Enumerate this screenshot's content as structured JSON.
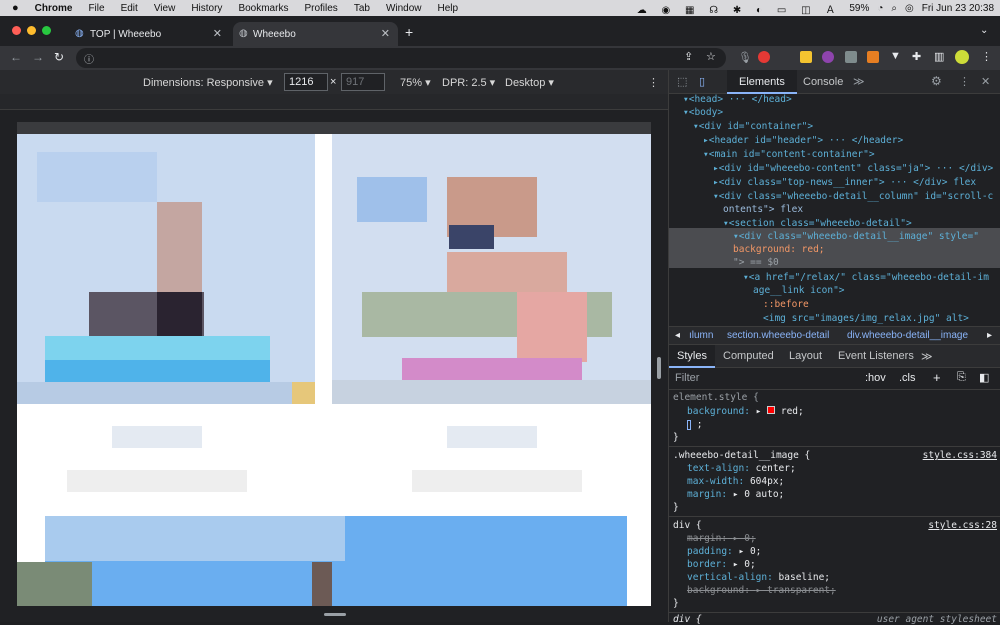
{
  "menubar": {
    "apple": "",
    "app": "Chrome",
    "items": [
      "File",
      "Edit",
      "View",
      "History",
      "Bookmarks",
      "Profiles",
      "Tab",
      "Window",
      "Help"
    ],
    "battery": "59%",
    "datetime": "Fri Jun 23  20:38"
  },
  "tabs": [
    {
      "title": "TOP | Wheeebo",
      "close": "✕"
    },
    {
      "title": "Wheeebo",
      "close": "✕"
    }
  ],
  "new_tab": "+",
  "devbar": {
    "dimensions": "Dimensions: Responsive ▾",
    "width": "1216",
    "times": "×",
    "height": "917",
    "zoom": "75% ▾",
    "dpr": "DPR: 2.5 ▾",
    "device": "Desktop ▾"
  },
  "devtools": {
    "tabs": [
      "Elements",
      "Console"
    ],
    "more": "≫"
  },
  "dom": [
    {
      "t": "▾<head> ··· </head>"
    },
    {
      "t": "▾<body>"
    },
    {
      "t": "▾<div id=\"container\">"
    },
    {
      "t": "▸<header id=\"header\"> ··· </header>"
    },
    {
      "t": "▾<main id=\"content-container\">"
    },
    {
      "t": "▸<div id=\"wheeebo-content\" class=\"ja\"> ··· </div>"
    },
    {
      "t": "▸<div class=\"top-news__inner\"> ··· </div>  flex"
    },
    {
      "t": "▾<div class=\"wheeebo-detail__column\" id=\"scroll-c"
    },
    {
      "t": "ontents\">  flex"
    },
    {
      "t": "▾<section class=\"wheeebo-detail\">"
    },
    {
      "t": "▾<div class=\"wheeebo-detail__image\" style=\""
    },
    {
      "t": "    background: red;"
    },
    {
      "t": "\"> == $0"
    },
    {
      "t": "▾<a href=\"/relax/\" class=\"wheeebo-detail-im"
    },
    {
      "t": "age__link icon\">"
    },
    {
      "t": "::before"
    },
    {
      "t": "<img src=\"images/img_relax.jpg\" alt>"
    }
  ],
  "crumbs": [
    "◂",
    "ılumn",
    "section.wheeebo-detail",
    "div.wheeebo-detail__image",
    "▸"
  ],
  "styles_tabs": [
    "Styles",
    "Computed",
    "Layout",
    "Event Listeners",
    "≫"
  ],
  "filter": {
    "placeholder": "Filter",
    "hov": ":hov",
    "cls": ".cls",
    "plus": "+"
  },
  "rules": {
    "element_style": "element.style {",
    "bg_prop": "background:",
    "bg_val": "red;",
    "cursor_line": ";",
    "close": "}",
    "r1_sel": ".wheeebo-detail__image {",
    "r1_src": "style.css:384",
    "r1_p1": "text-align:",
    "r1_v1": "center;",
    "r1_p2": "max-width:",
    "r1_v2": "604px;",
    "r1_p3": "margin:",
    "r1_v3": "▸ 0 auto;",
    "r2_sel": "div {",
    "r2_src": "style.css:28",
    "r2_p1": "margin:",
    "r2_v1": "▸ 0;",
    "r2_p2": "padding:",
    "r2_v2": "▸ 0;",
    "r2_p3": "border:",
    "r2_v3": "▸ 0;",
    "r2_p4": "vertical-align:",
    "r2_v4": "baseline;",
    "r2_p5": "background:",
    "r2_v5": "▸ transparent;",
    "r3_sel": "div {",
    "r3_src": "user agent stylesheet"
  }
}
